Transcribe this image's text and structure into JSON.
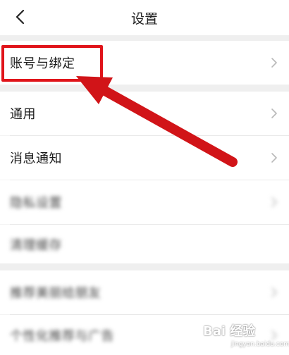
{
  "header": {
    "title": "设置",
    "back_icon": "chevron-left-icon"
  },
  "menu": {
    "items": [
      {
        "label": "账号与绑定",
        "blurred": false
      },
      {
        "label": "通用",
        "blurred": false
      },
      {
        "label": "消息通知",
        "blurred": false
      },
      {
        "label": "隐私设置",
        "blurred": true
      },
      {
        "label": "清理缓存",
        "blurred": true
      },
      {
        "label": "推荐美丽给朋友",
        "blurred": true
      },
      {
        "label": "个性化推荐与广告",
        "blurred": true
      }
    ]
  },
  "annotation": {
    "color": "#e0141a"
  },
  "watermark": {
    "brand": "Bai 经验",
    "site": "jingyan.baidu.com"
  }
}
